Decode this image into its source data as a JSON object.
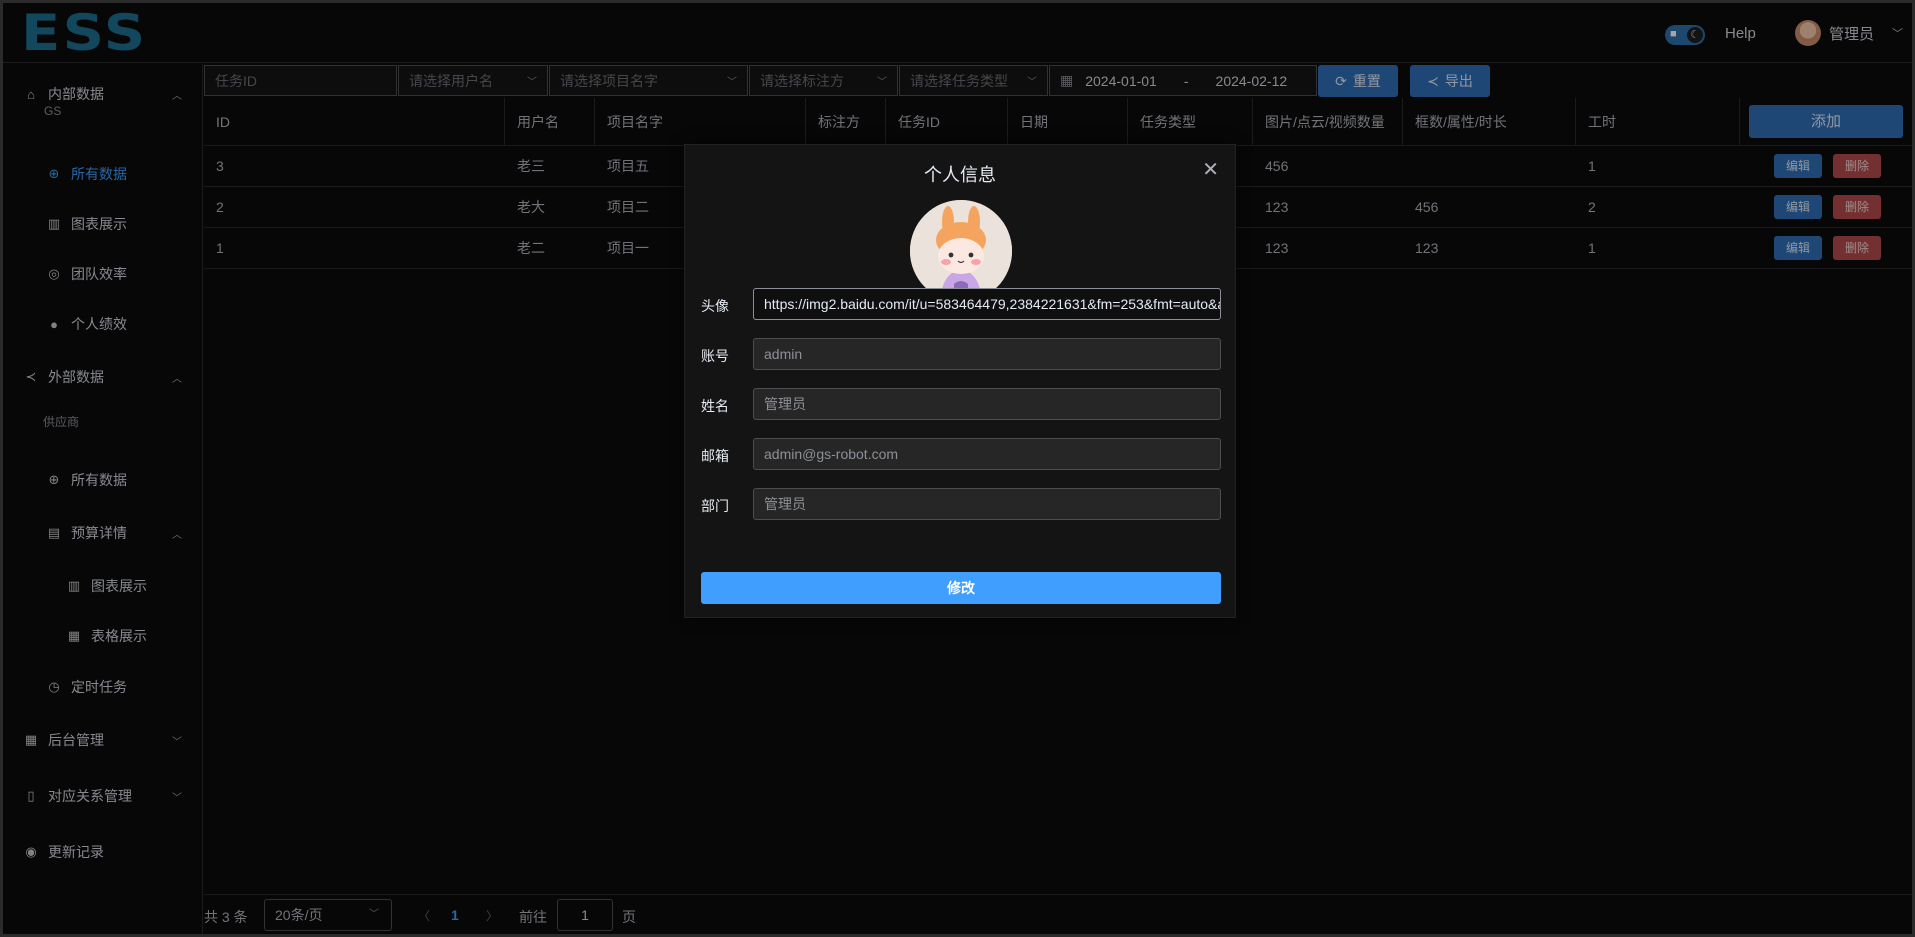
{
  "header": {
    "logo": "ESS",
    "help": "Help",
    "user_name": "管理员"
  },
  "sidebar": {
    "internal": "内部数据",
    "gs": "GS",
    "internal_items": [
      "所有数据",
      "图表展示",
      "团队效率",
      "个人绩效"
    ],
    "external": "外部数据",
    "supplier": "供应商",
    "external_all": "所有数据",
    "budget": "预算详情",
    "budget_items": [
      "图表展示",
      "表格展示"
    ],
    "timer": "定时任务",
    "admin": "后台管理",
    "mapping": "对应关系管理",
    "changelog": "更新记录"
  },
  "filters": {
    "task_id": "任务ID",
    "user": "请选择用户名",
    "project": "请选择项目名字",
    "annotator": "请选择标注方",
    "task_type": "请选择任务类型",
    "date_start": "2024-01-01",
    "date_sep": "-",
    "date_end": "2024-02-12",
    "reset": "重置",
    "export": "导出"
  },
  "table": {
    "columns": [
      "ID",
      "用户名",
      "项目名字",
      "标注方",
      "任务ID",
      "日期",
      "任务类型",
      "图片/点云/视频数量",
      "框数/属性/时长",
      "工时"
    ],
    "add": "添加",
    "edit": "编辑",
    "delete": "删除",
    "rows": [
      {
        "id": "3",
        "user": "老三",
        "project": "项目五",
        "count": "456",
        "boxes": "",
        "hours": "1"
      },
      {
        "id": "2",
        "user": "老大",
        "project": "项目二",
        "count": "123",
        "boxes": "456",
        "hours": "2"
      },
      {
        "id": "1",
        "user": "老二",
        "project": "项目一",
        "count": "123",
        "boxes": "123",
        "hours": "1"
      }
    ]
  },
  "pager": {
    "total": "共 3 条",
    "size": "20条/页",
    "page": "1",
    "goto": "前往",
    "goto_value": "1",
    "unit": "页"
  },
  "dialog": {
    "title": "个人信息",
    "labels": {
      "avatar": "头像",
      "account": "账号",
      "name": "姓名",
      "email": "邮箱",
      "dept": "部门"
    },
    "avatar_url": "https://img2.baidu.com/it/u=583464479,2384221631&fm=253&fmt=auto&app=138&f=JPEG",
    "account": "admin",
    "name": "管理员",
    "email": "admin@gs-robot.com",
    "dept": "管理员",
    "submit": "修改"
  },
  "colors": {
    "accent": "#409eff",
    "button": "#2e6db5",
    "danger": "#b24a4a",
    "logo": "#1c6e8f"
  }
}
